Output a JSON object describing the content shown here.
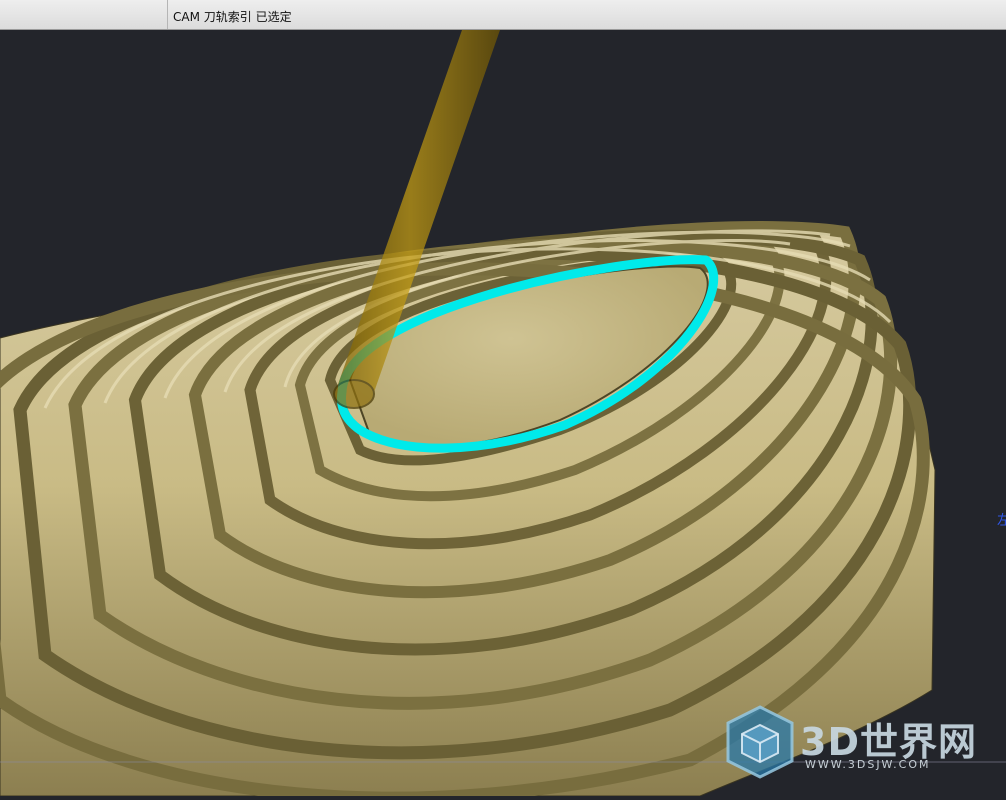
{
  "title_bar": {
    "status_text": "CAM 刀轨索引 已选定"
  },
  "viewport": {
    "background_color": "#23252b",
    "part_color": "#cdc08e",
    "toolpath_color": "#00eaea",
    "tool_color": "#b08a0e",
    "axis_hint": "左"
  },
  "watermark": {
    "brand": "3D世界网",
    "url": "WWW.3DSJW.COM",
    "icon": "cube-logo-icon"
  }
}
